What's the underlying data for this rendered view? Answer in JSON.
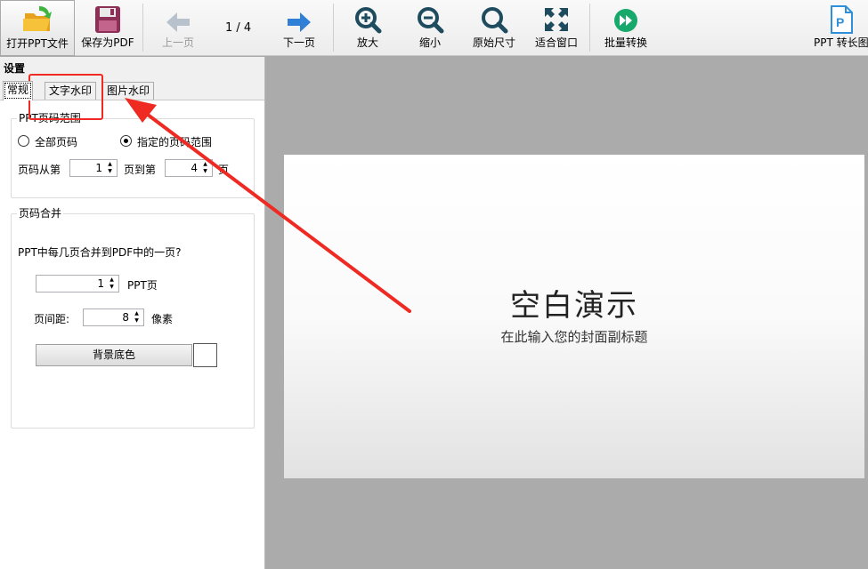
{
  "toolbar": {
    "open_label": "打开PPT文件",
    "save_label": "保存为PDF",
    "prev_label": "上一页",
    "page_indicator": "1 / 4",
    "next_label": "下一页",
    "zoom_in_label": "放大",
    "zoom_out_label": "缩小",
    "original_size_label": "原始尺寸",
    "fit_window_label": "适合窗口",
    "batch_label": "批量转换",
    "ppt_long_label": "PPT 转长图"
  },
  "panel": {
    "title": "设置",
    "tabs": [
      "常规",
      "文字水印",
      "图片水印"
    ],
    "page_range": {
      "group_title": "PPT页码范围",
      "all_pages": "全部页码",
      "specified": "指定的页码范围",
      "from_label": "页码从第",
      "from_value": "1",
      "to_label": "页到第",
      "to_value": "4",
      "end_label": "页"
    },
    "merge": {
      "group_title": "页码合并",
      "question": "PPT中每几页合并到PDF中的一页?",
      "ppt_count": "1",
      "ppt_unit": "PPT页",
      "spacing_label": "页间距:",
      "spacing_value": "8",
      "spacing_unit": "像素",
      "bg_button": "背景底色",
      "bg_color": "#ffffff"
    }
  },
  "slide": {
    "title": "空白演示",
    "subtitle": "在此输入您的封面副标题"
  },
  "colors": {
    "annotation": "#ee2a23",
    "arrow_blue": "#2f7fd6",
    "batch_green": "#17a86b"
  }
}
